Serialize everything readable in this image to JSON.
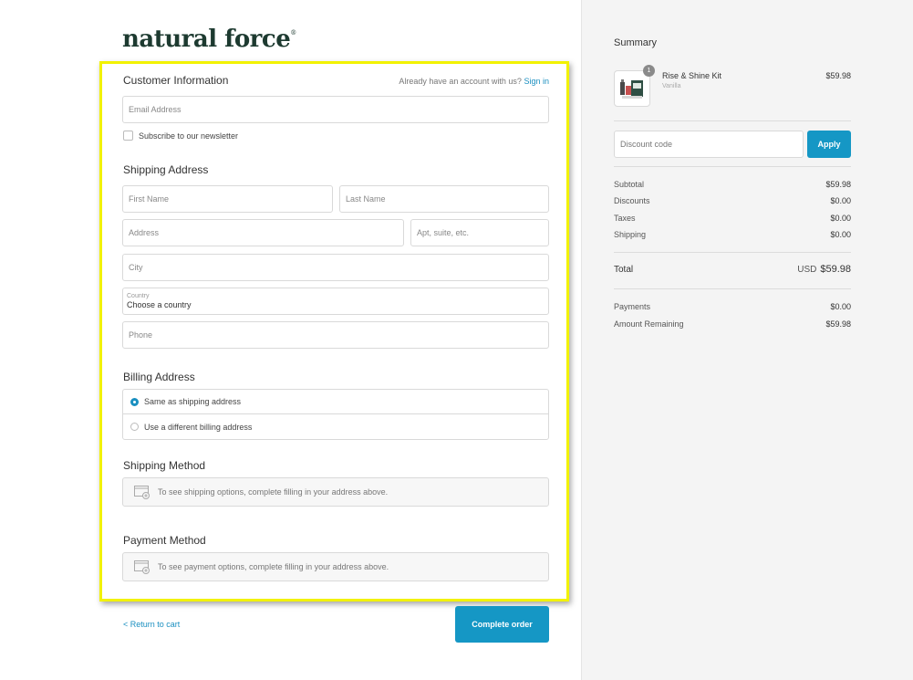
{
  "brand": {
    "logo_text": "natural force",
    "logo_mark": "®"
  },
  "customer": {
    "title": "Customer Information",
    "account_prompt": "Already have an account with us?",
    "sign_in": "Sign in",
    "email_placeholder": "Email Address",
    "newsletter_label": "Subscribe to our newsletter"
  },
  "shipping_address": {
    "title": "Shipping Address",
    "first_name": "First Name",
    "last_name": "Last Name",
    "address": "Address",
    "apt": "Apt, suite, etc.",
    "city": "City",
    "country_label": "Country",
    "country_value": "Choose a country",
    "phone": "Phone"
  },
  "billing": {
    "title": "Billing Address",
    "option_same": "Same as shipping address",
    "option_different": "Use a different billing address",
    "selected": "same"
  },
  "shipping_method": {
    "title": "Shipping Method",
    "message": "To see shipping options, complete filling in your address above."
  },
  "payment_method": {
    "title": "Payment Method",
    "message": "To see payment options, complete filling in your address above."
  },
  "footer": {
    "return_link": "< Return to cart",
    "complete_button": "Complete order"
  },
  "summary": {
    "title": "Summary",
    "item": {
      "quantity": "1",
      "name": "Rise & Shine Kit",
      "variant": "Vanilla",
      "price": "$59.98"
    },
    "discount_placeholder": "Discount code",
    "apply_button": "Apply",
    "lines": [
      {
        "label": "Subtotal",
        "value": "$59.98"
      },
      {
        "label": "Discounts",
        "value": "$0.00"
      },
      {
        "label": "Taxes",
        "value": "$0.00"
      },
      {
        "label": "Shipping",
        "value": "$0.00"
      }
    ],
    "total_label": "Total",
    "total_currency": "USD",
    "total_value": "$59.98",
    "payments_label": "Payments",
    "payments_value": "$0.00",
    "remaining_label": "Amount Remaining",
    "remaining_value": "$59.98"
  },
  "colors": {
    "accent": "#1597c5",
    "highlight": "#f2f200",
    "brand": "#1d3a30"
  }
}
